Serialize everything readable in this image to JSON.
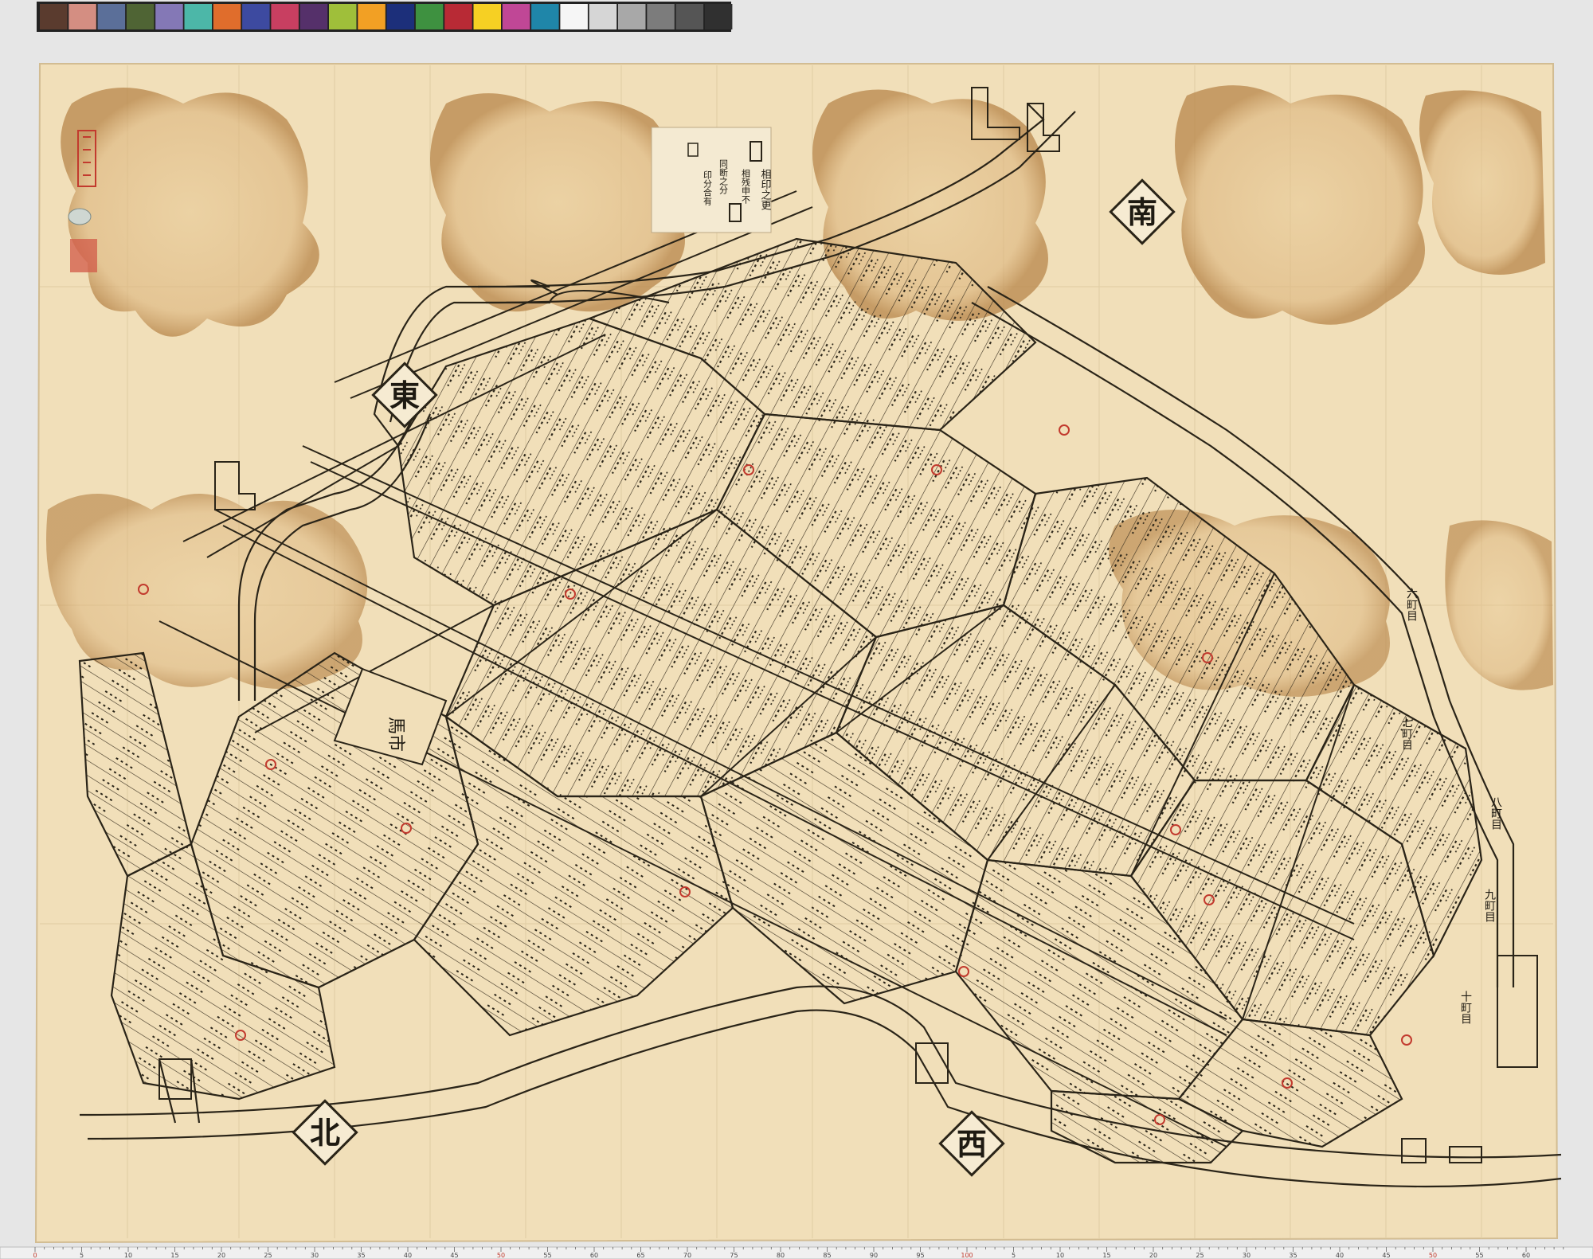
{
  "color_bar": {
    "swatches": [
      "#5a3b2e",
      "#d48e82",
      "#5b6f99",
      "#4f6434",
      "#8478b6",
      "#4cb7a8",
      "#e06d2c",
      "#3d4aa0",
      "#c83f61",
      "#55306a",
      "#9fbf3a",
      "#f2a024",
      "#1c2f7a",
      "#3e9140",
      "#b82a35",
      "#f6d023",
      "#c04796",
      "#1f86a9",
      "#f6f6f6",
      "#d6d6d6",
      "#a8a8a8",
      "#7c7c7c",
      "#555555",
      "#303030"
    ]
  },
  "ruler": {
    "labels": [
      "0",
      "5",
      "10",
      "15",
      "20",
      "25",
      "30",
      "35",
      "40",
      "45",
      "50",
      "55",
      "60",
      "65",
      "70",
      "75",
      "80",
      "85",
      "90",
      "95",
      "100",
      "5",
      "10",
      "15",
      "20",
      "25",
      "30",
      "35",
      "40",
      "45",
      "50",
      "55",
      "60"
    ],
    "highlight_labels": [
      "0",
      "50",
      "100",
      "50"
    ],
    "highlight_color": "#c0392b"
  },
  "compass": {
    "east": "東",
    "north": "北",
    "west": "西",
    "south": "南"
  },
  "labels": {
    "market": "馬市",
    "block_8": "八町目",
    "block_9": "九町目",
    "block_10": "十町目",
    "block_6": "六町目",
    "block_7": "七町目"
  },
  "legend": {
    "line1": "相印之更",
    "line2": "相残申不",
    "line3": "同断之分",
    "line4": "印分合有"
  },
  "colors": {
    "paper": "#f1dfb9",
    "stain": "#d9b07b",
    "ink": "#2a2418",
    "seal": "#c23a2e"
  }
}
